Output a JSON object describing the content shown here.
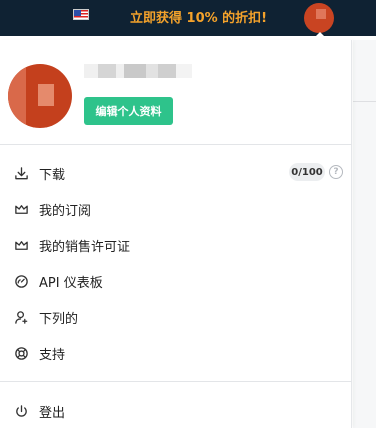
{
  "topbar": {
    "promo_text": "立即获得 10% 的折扣!",
    "flag_icon": "us-flag-icon",
    "bg_color": "#0f2233",
    "promo_color": "#f4a22b"
  },
  "profile": {
    "edit_label": "编辑个人资料",
    "edit_color": "#2ec38b"
  },
  "menu": {
    "download": {
      "label": "下载",
      "icon": "download-icon",
      "quota": "0/100",
      "help": "?"
    },
    "subscription": {
      "label": "我的订阅",
      "icon": "crown-icon"
    },
    "licenses": {
      "label": "我的销售许可证",
      "icon": "crown-icon"
    },
    "dashboard": {
      "label": "API 仪表板",
      "icon": "gauge-icon"
    },
    "following": {
      "label": "下列的",
      "icon": "user-follow-icon"
    },
    "support": {
      "label": "支持",
      "icon": "lifebuoy-icon"
    },
    "logout": {
      "label": "登出",
      "icon": "power-icon"
    }
  }
}
